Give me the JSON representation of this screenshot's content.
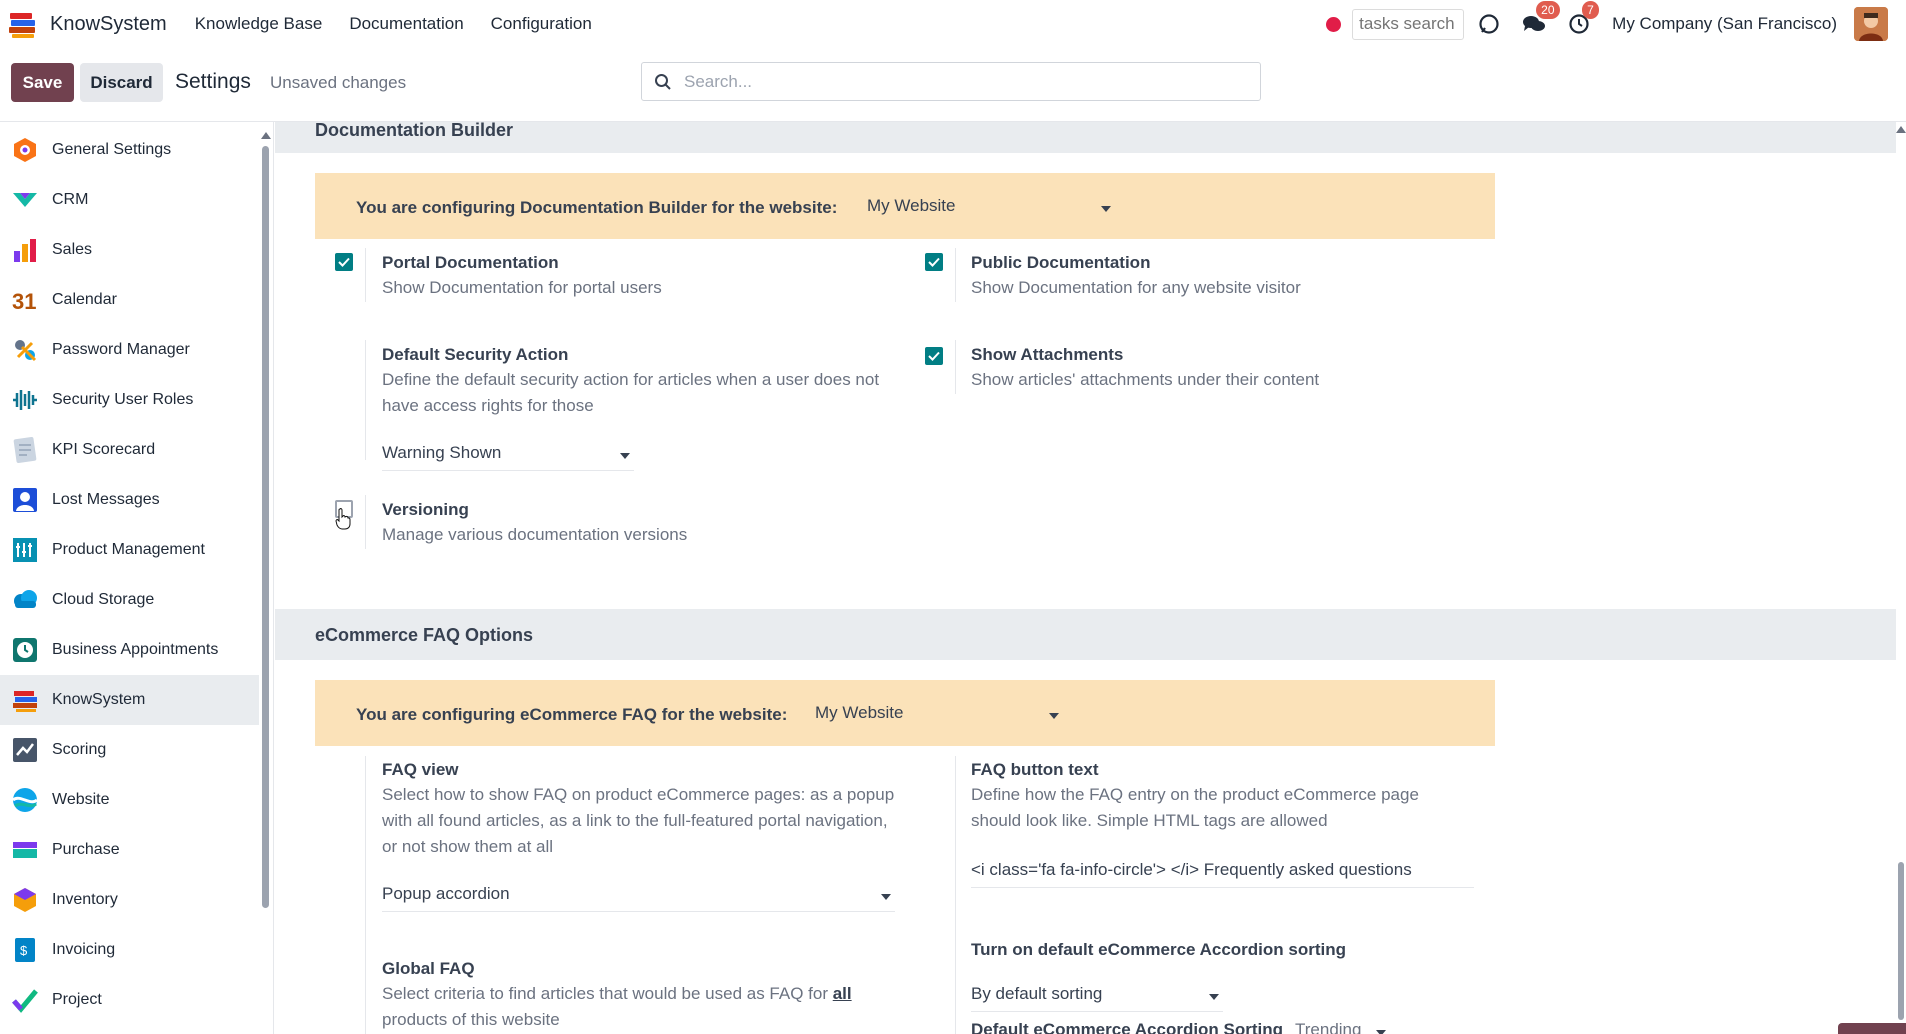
{
  "app": {
    "name": "KnowSystem",
    "menu": [
      "Knowledge Base",
      "Documentation",
      "Configuration"
    ]
  },
  "systray": {
    "tasks_search_placeholder": "tasks search",
    "messages_count": "20",
    "activities_count": "7",
    "company": "My Company (San Francisco)"
  },
  "control_panel": {
    "save_label": "Save",
    "discard_label": "Discard",
    "title": "Settings",
    "status": "Unsaved changes",
    "search_placeholder": "Search..."
  },
  "sidebar": {
    "items": [
      {
        "label": "General Settings",
        "icon": "general-settings-icon",
        "color": "#f97316"
      },
      {
        "label": "CRM",
        "icon": "crm-icon",
        "color": "#14b8a6"
      },
      {
        "label": "Sales",
        "icon": "sales-icon",
        "color": "#f59e0b"
      },
      {
        "label": "Calendar",
        "icon": "calendar-icon",
        "color": "#e11d48"
      },
      {
        "label": "Password Manager",
        "icon": "password-manager-icon",
        "color": "#64748b"
      },
      {
        "label": "Security User Roles",
        "icon": "security-roles-icon",
        "color": "#0e7490"
      },
      {
        "label": "KPI Scorecard",
        "icon": "kpi-scorecard-icon",
        "color": "#94a3b8"
      },
      {
        "label": "Lost Messages",
        "icon": "lost-messages-icon",
        "color": "#1d4ed8"
      },
      {
        "label": "Product Management",
        "icon": "product-management-icon",
        "color": "#0891b2"
      },
      {
        "label": "Cloud Storage",
        "icon": "cloud-storage-icon",
        "color": "#0284c7"
      },
      {
        "label": "Business Appointments",
        "icon": "business-appointments-icon",
        "color": "#0f766e"
      },
      {
        "label": "KnowSystem",
        "icon": "knowsystem-icon",
        "color": "#b45309"
      },
      {
        "label": "Scoring",
        "icon": "scoring-icon",
        "color": "#475569"
      },
      {
        "label": "Website",
        "icon": "website-icon",
        "color": "#0ea5e9"
      },
      {
        "label": "Purchase",
        "icon": "purchase-icon",
        "color": "#14b8a6"
      },
      {
        "label": "Inventory",
        "icon": "inventory-icon",
        "color": "#f59e0b"
      },
      {
        "label": "Invoicing",
        "icon": "invoicing-icon",
        "color": "#0284c7"
      },
      {
        "label": "Project",
        "icon": "project-icon",
        "color": "#10b981"
      }
    ],
    "active": "KnowSystem"
  },
  "doc_builder": {
    "section_title": "Documentation Builder",
    "website_label": "You are configuring Documentation Builder for the website:",
    "website_value": "My Website",
    "portal_doc": {
      "title": "Portal Documentation",
      "desc": "Show Documentation for portal users",
      "checked": true
    },
    "public_doc": {
      "title": "Public Documentation",
      "desc": "Show Documentation for any website visitor",
      "checked": true
    },
    "security_action": {
      "title": "Default Security Action",
      "desc": "Define the default security action for articles when a user does not have access rights for those",
      "value": "Warning Shown"
    },
    "show_attachments": {
      "title": "Show Attachments",
      "desc": "Show articles' attachments under their content",
      "checked": true
    },
    "versioning": {
      "title": "Versioning",
      "desc": "Manage various documentation versions",
      "checked": false
    }
  },
  "faq": {
    "section_title": "eCommerce FAQ Options",
    "website_label": "You are configuring eCommerce FAQ for the website:",
    "website_value": "My Website",
    "faq_view": {
      "title": "FAQ view",
      "desc": "Select how to show FAQ on product eCommerce pages: as a popup with all found articles, as a link to the full-featured portal navigation, or not show them at all",
      "value": "Popup accordion"
    },
    "faq_button": {
      "title": "FAQ button text",
      "desc": "Define how the FAQ entry on the product eCommerce page should look like. Simple HTML tags are allowed",
      "value": "<i class='fa fa-info-circle'> </i> Frequently asked questions"
    },
    "global_faq": {
      "title": "Global FAQ",
      "desc_before": "Select criteria to find articles that would be used as FAQ for ",
      "desc_bold": "all",
      "desc_after": "products of this website"
    },
    "sorting": {
      "title": "Turn on default eCommerce Accordion sorting",
      "value": "By default sorting",
      "sub_title": "Default eCommerce Accordion Sorting",
      "sub_value": "Trending"
    }
  },
  "colors": {
    "brand": "#71414f",
    "checkbox": "#017e84",
    "website_bar": "#fbe2b9"
  }
}
